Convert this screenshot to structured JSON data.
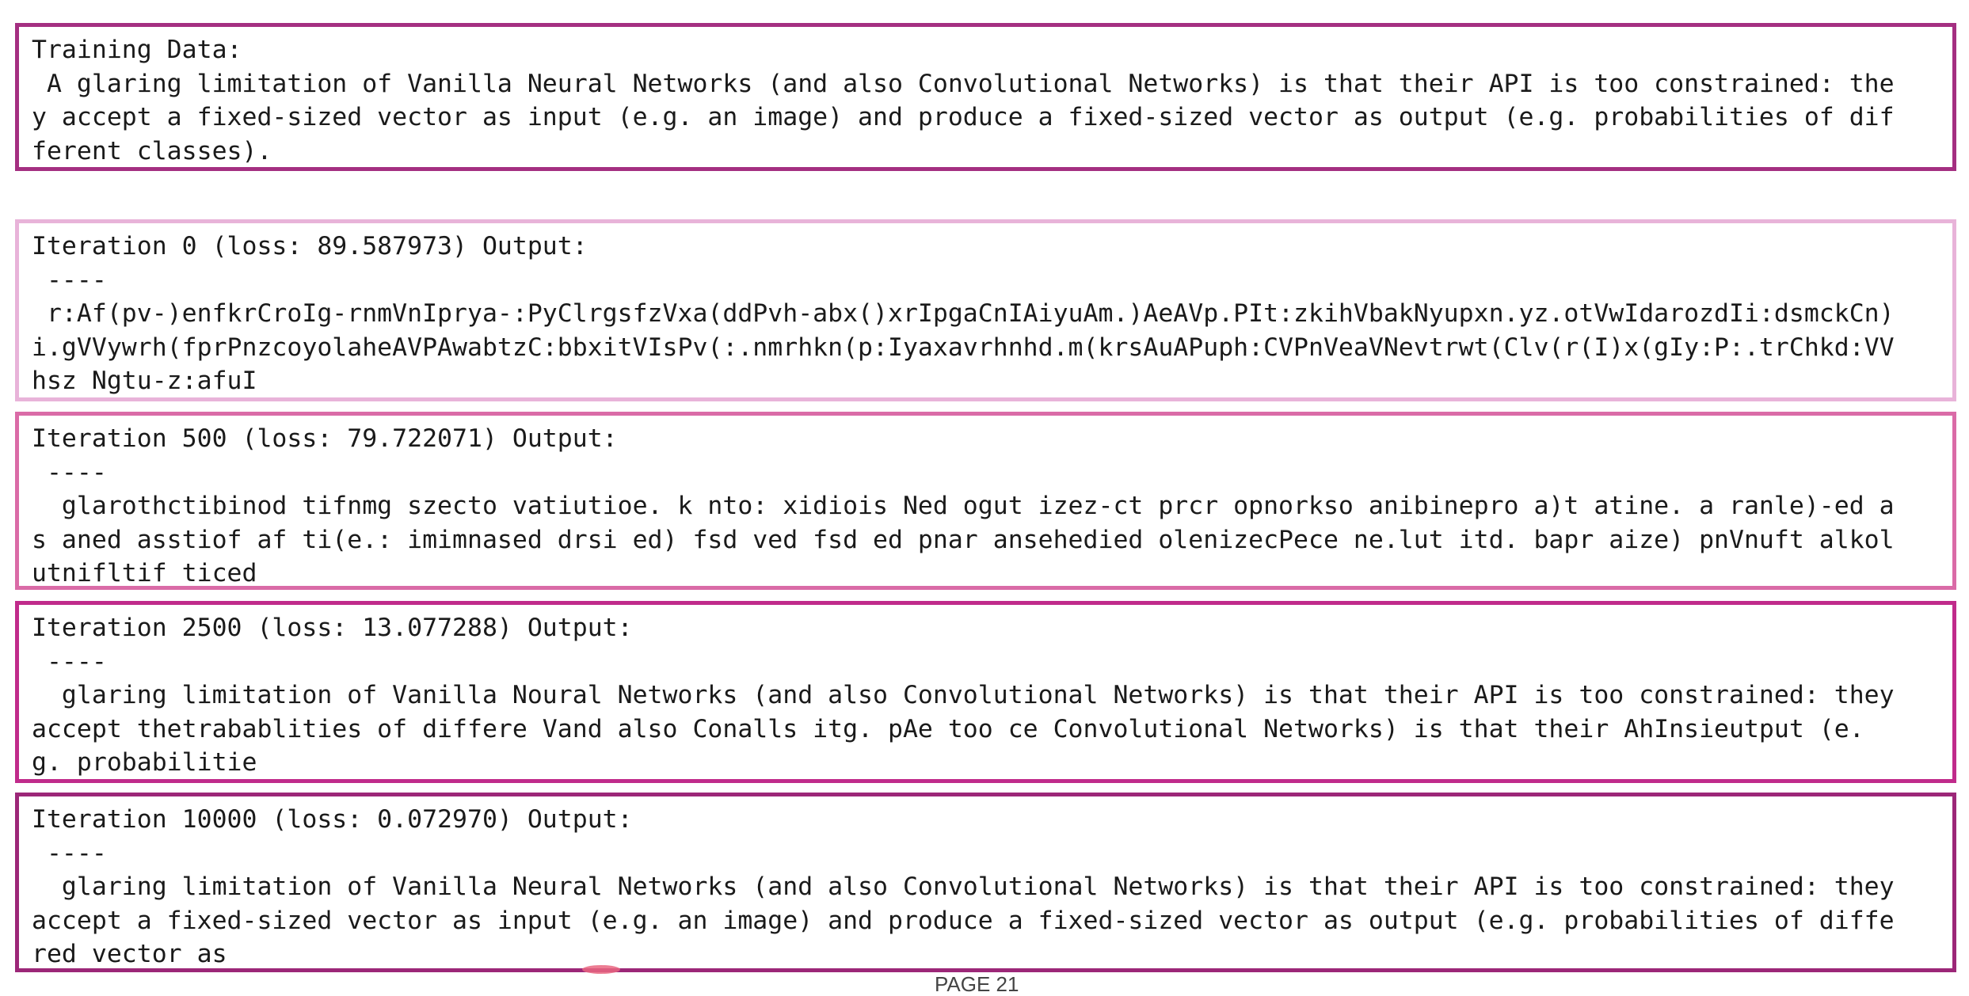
{
  "training": {
    "header": "Training Data:",
    "lines": [
      " A glaring limitation of Vanilla Neural Networks (and also Convolutional Networks) is that their API is too constrained: the",
      "y accept a fixed-sized vector as input (e.g. an image) and produce a fixed-sized vector as output (e.g. probabilities of dif",
      "ferent classes)."
    ]
  },
  "iterations": [
    {
      "header": "Iteration 0 (loss: 89.587973) Output:",
      "separator": " ----",
      "lines": [
        " r:Af(pv-)enfkrCroIg-rnmVnIprya-:PyClrgsfzVxa(ddPvh-abx()xrIpgaCnIAiyuAm.)AeAVp.PIt:zkihVbakNyupxn.yz.otVwIdarozdIi:dsmckCn)",
        "i.gVVywrh(fprPnzcoyolaheAVPAwabtzC:bbxitVIsPv(:.nmrhkn(p:Iyaxavrhnhd.m(krsAuAPuph:CVPnVeaVNevtrwt(Clv(r(I)x(gIy:P:.trChkd:VV",
        "hsz Ngtu-z:afuI"
      ]
    },
    {
      "header": "Iteration 500 (loss: 79.722071) Output:",
      "separator": " ----",
      "lines": [
        "  glarothctibinod tifnmg szecto vatiutioe. k nto: xidiois Ned ogut izez-ct prcr opnorkso anibinepro a)t atine. a ranle)-ed a",
        "s aned asstiof af ti(e.: imimnased drsi ed) fsd ved fsd ed pnar ansehedied olenizecPece ne.lut itd. bapr aize) pnVnuft alkol",
        "utnifltif ticed"
      ]
    },
    {
      "header": "Iteration 2500 (loss: 13.077288) Output:",
      "separator": " ----",
      "lines": [
        "  glaring limitation of Vanilla Noural Networks (and also Convolutional Networks) is that their API is too constrained: they",
        "accept thetrabablities of differe Vand also Conalls itg. pAe too ce Convolutional Networks) is that their AhInsieutput (e.",
        "g. probabilitie"
      ]
    },
    {
      "header": "Iteration 10000 (loss: 0.072970) Output:",
      "separator": " ----",
      "lines": [
        "  glaring limitation of Vanilla Neural Networks (and also Convolutional Networks) is that their API is too constrained: they",
        "accept a fixed-sized vector as input (e.g. an image) and produce a fixed-sized vector as output (e.g. probabilities of diffe",
        "red vector as"
      ]
    }
  ],
  "footer": {
    "text": "PAGE 21"
  },
  "colors": {
    "training_border": "#a42f81",
    "iter0_border": "#e8b3d9",
    "iter500_border": "#da6ba7",
    "iter2500_border": "#c02b8b",
    "iter10000_border": "#9c2778"
  }
}
